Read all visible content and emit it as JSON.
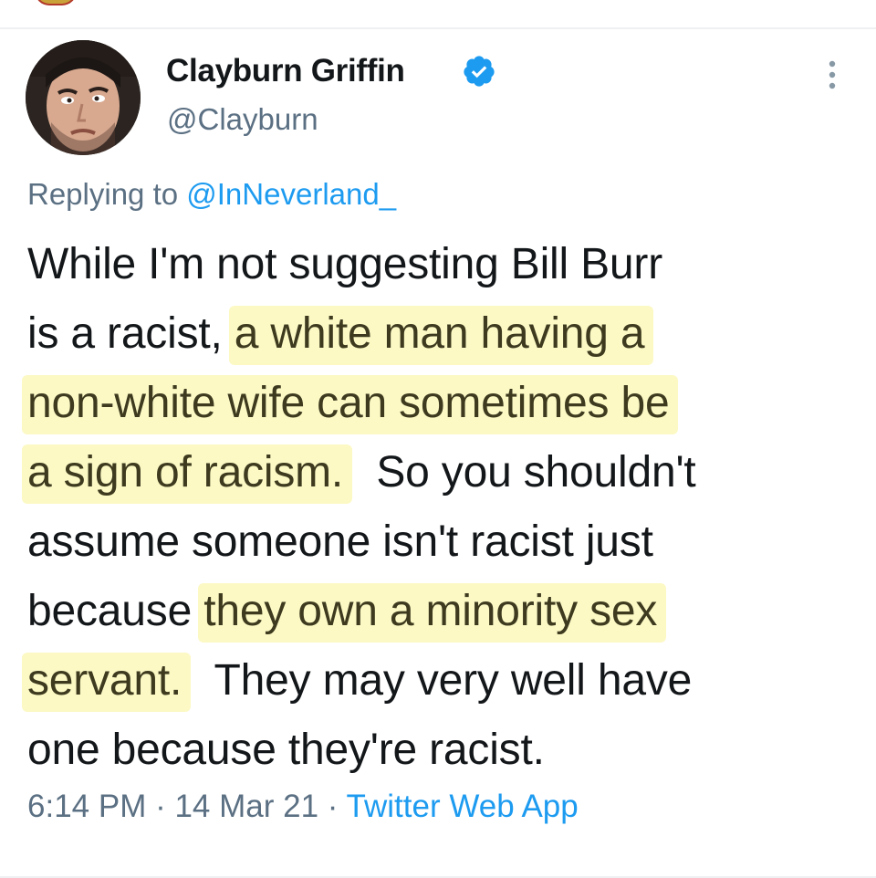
{
  "author": {
    "display_name": "Clayburn Griffin",
    "handle": "@Clayburn",
    "avatar_icon": "profile-photo",
    "verified_icon": "verified-badge-icon",
    "verified_color": "#1d9bf0"
  },
  "reply": {
    "prefix": "Replying to ",
    "mention": "@InNeverland_"
  },
  "tweet": {
    "lines": [
      [
        {
          "t": "While I'm not suggesting Bill Burr",
          "h": false
        }
      ],
      [
        {
          "t": "is a racist, ",
          "h": false
        },
        {
          "t": "a white man having a",
          "h": true
        }
      ],
      [
        {
          "t": "non-white wife can sometimes be",
          "h": true
        }
      ],
      [
        {
          "t": "a sign of racism.",
          "h": true
        },
        {
          "t": "  So you shouldn't",
          "h": false
        }
      ],
      [
        {
          "t": "assume someone isn't racist just",
          "h": false
        }
      ],
      [
        {
          "t": "because ",
          "h": false
        },
        {
          "t": "they own a minority sex",
          "h": true
        }
      ],
      [
        {
          "t": "servant.",
          "h": true
        },
        {
          "t": "  They may very well have",
          "h": false
        }
      ],
      [
        {
          "t": "one because they're racist.",
          "h": false
        }
      ]
    ],
    "highlight_color": "#fcf9c5"
  },
  "meta": {
    "time": "6:14 PM",
    "sep1": " · ",
    "date": "14 Mar 21",
    "sep2": " · ",
    "source": "Twitter Web App"
  },
  "colors": {
    "text": "#14171a",
    "secondary": "#5b7083",
    "link": "#1d9bf0"
  }
}
